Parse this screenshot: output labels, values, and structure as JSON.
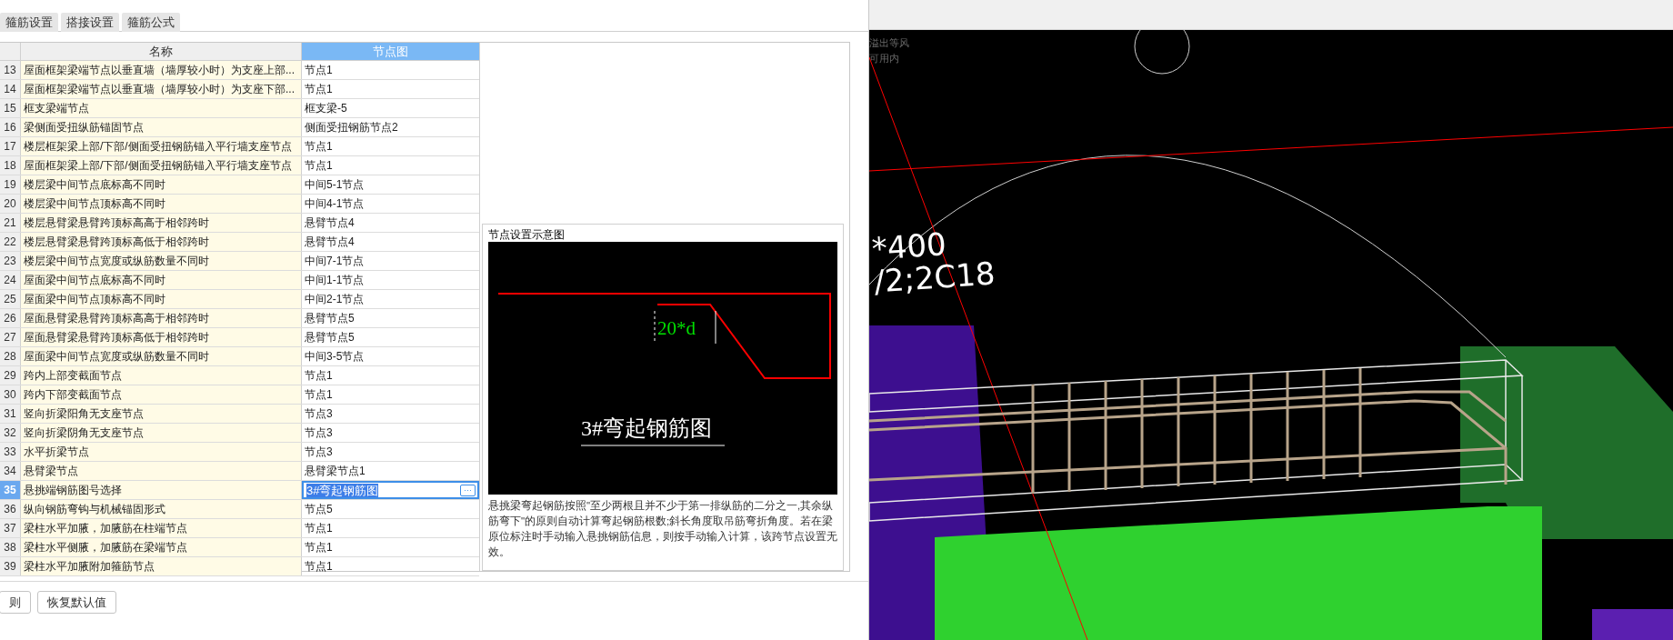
{
  "tabs": [
    {
      "label": "箍筋设置"
    },
    {
      "label": "搭接设置"
    },
    {
      "label": "箍筋公式"
    }
  ],
  "table": {
    "columns": [
      {
        "label": "名称",
        "selected": false
      },
      {
        "label": "节点图",
        "selected": true
      }
    ],
    "rows": [
      {
        "number": "13",
        "name": "屋面框架梁端节点以垂直墙（墙厚较小时）为支座上部...",
        "node": "节点1",
        "selected": false
      },
      {
        "number": "14",
        "name": "屋面框架梁端节点以垂直墙（墙厚较小时）为支座下部...",
        "node": "节点1",
        "selected": false
      },
      {
        "number": "15",
        "name": "框支梁端节点",
        "node": "框支梁-5",
        "selected": false
      },
      {
        "number": "16",
        "name": "梁侧面受扭纵筋锚固节点",
        "node": "侧面受扭钢筋节点2",
        "selected": false
      },
      {
        "number": "17",
        "name": "楼层框架梁上部/下部/侧面受扭钢筋锚入平行墙支座节点",
        "node": "节点1",
        "selected": false
      },
      {
        "number": "18",
        "name": "屋面框架梁上部/下部/侧面受扭钢筋锚入平行墙支座节点",
        "node": "节点1",
        "selected": false
      },
      {
        "number": "19",
        "name": "楼层梁中间节点底标高不同时",
        "node": "中间5-1节点",
        "selected": false
      },
      {
        "number": "20",
        "name": "楼层梁中间节点顶标高不同时",
        "node": "中间4-1节点",
        "selected": false
      },
      {
        "number": "21",
        "name": "楼层悬臂梁悬臂跨顶标高高于相邻跨时",
        "node": "悬臂节点4",
        "selected": false
      },
      {
        "number": "22",
        "name": "楼层悬臂梁悬臂跨顶标高低于相邻跨时",
        "node": "悬臂节点4",
        "selected": false
      },
      {
        "number": "23",
        "name": "楼层梁中间节点宽度或纵筋数量不同时",
        "node": "中间7-1节点",
        "selected": false
      },
      {
        "number": "24",
        "name": "屋面梁中间节点底标高不同时",
        "node": "中间1-1节点",
        "selected": false
      },
      {
        "number": "25",
        "name": "屋面梁中间节点顶标高不同时",
        "node": "中间2-1节点",
        "selected": false
      },
      {
        "number": "26",
        "name": "屋面悬臂梁悬臂跨顶标高高于相邻跨时",
        "node": "悬臂节点5",
        "selected": false
      },
      {
        "number": "27",
        "name": "屋面悬臂梁悬臂跨顶标高低于相邻跨时",
        "node": "悬臂节点5",
        "selected": false
      },
      {
        "number": "28",
        "name": "屋面梁中间节点宽度或纵筋数量不同时",
        "node": "中间3-5节点",
        "selected": false
      },
      {
        "number": "29",
        "name": "跨内上部变截面节点",
        "node": "节点1",
        "selected": false
      },
      {
        "number": "30",
        "name": "跨内下部变截面节点",
        "node": "节点1",
        "selected": false
      },
      {
        "number": "31",
        "name": "竖向折梁阳角无支座节点",
        "node": "节点3",
        "selected": false
      },
      {
        "number": "32",
        "name": "竖向折梁阴角无支座节点",
        "node": "节点3",
        "selected": false
      },
      {
        "number": "33",
        "name": "水平折梁节点",
        "node": "节点3",
        "selected": false
      },
      {
        "number": "34",
        "name": "悬臂梁节点",
        "node": "悬臂梁节点1",
        "selected": false
      },
      {
        "number": "35",
        "name": "悬挑端钢筋图号选择",
        "node": "3#弯起钢筋图",
        "selected": true
      },
      {
        "number": "36",
        "name": "纵向钢筋弯钩与机械锚固形式",
        "node": "节点5",
        "selected": false
      },
      {
        "number": "37",
        "name": "梁柱水平加腋，加腋筋在柱端节点",
        "node": "节点1",
        "selected": false
      },
      {
        "number": "38",
        "name": "梁柱水平侧腋，加腋筋在梁端节点",
        "node": "节点1",
        "selected": false
      },
      {
        "number": "39",
        "name": "梁柱水平加腋附加箍筋节点",
        "node": "节点1",
        "selected": false
      }
    ],
    "edit_button": "···"
  },
  "preview": {
    "title": "节点设置示意图",
    "dimension": "20*d",
    "caption": "3#弯起钢筋图",
    "description": "悬挑梁弯起钢筋按照\"至少两根且并不少于第一排纵筋的二分之一,其余纵筋弯下\"的原则自动计算弯起钢筋根数;斜长角度取吊筋弯折角度。若在梁原位标注时手动输入悬挑钢筋信息，则按手动输入计算，该跨节点设置无效。"
  },
  "buttons": [
    {
      "label": "则"
    },
    {
      "label": "恢复默认值"
    }
  ],
  "viewport": {
    "faint_labels": [
      "溢出等风",
      "可用内"
    ],
    "beam_labels": [
      "*400",
      "/2;2C18"
    ]
  }
}
